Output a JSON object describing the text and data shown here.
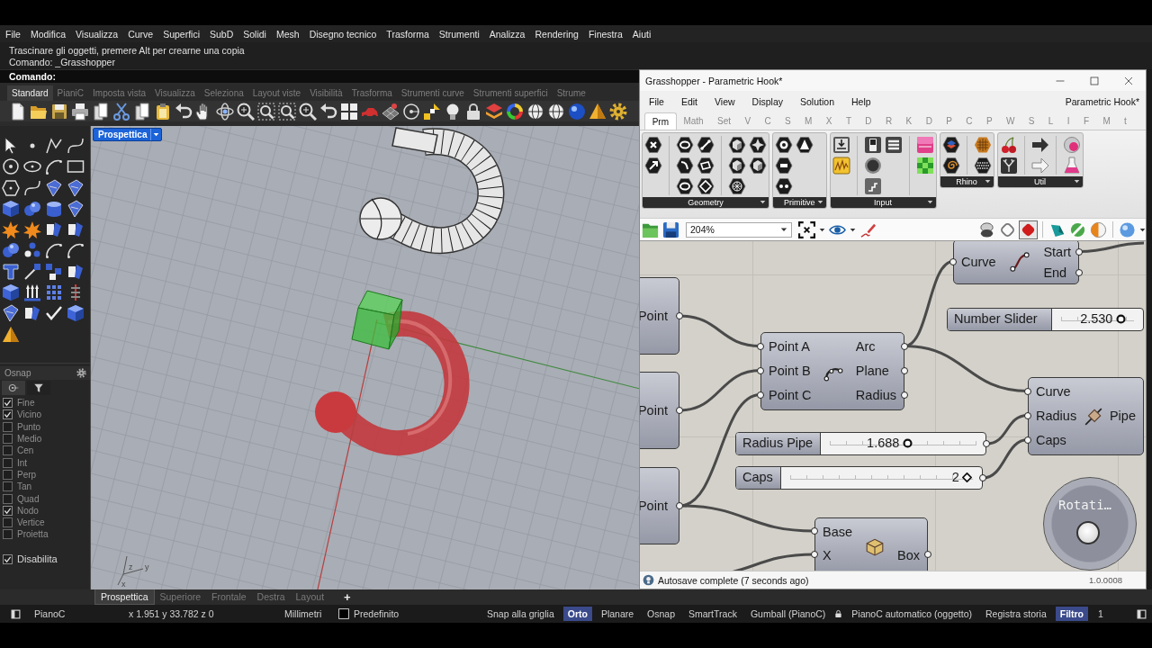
{
  "rhino": {
    "menu": [
      "File",
      "Modifica",
      "Visualizza",
      "Curve",
      "Superfici",
      "SubD",
      "Solidi",
      "Mesh",
      "Disegno tecnico",
      "Trasforma",
      "Strumenti",
      "Analizza",
      "Rendering",
      "Finestra",
      "Aiuti"
    ],
    "command_history": [
      "Trascinare gli oggetti, premere Alt per crearne una copia",
      "Comando: _Grasshopper"
    ],
    "command_prompt": "Comando:",
    "toolbar_tabs": [
      {
        "label": "Standard",
        "selected": true
      },
      {
        "label": "PianiC",
        "selected": false
      },
      {
        "label": "Imposta vista",
        "selected": false
      },
      {
        "label": "Visualizza",
        "selected": false
      },
      {
        "label": "Seleziona",
        "selected": false
      },
      {
        "label": "Layout viste",
        "selected": false
      },
      {
        "label": "Visibilità",
        "selected": false
      },
      {
        "label": "Trasforma",
        "selected": false
      },
      {
        "label": "Strumenti curve",
        "selected": false
      },
      {
        "label": "Strumenti superfici",
        "selected": false
      },
      {
        "label": "Strume",
        "selected": false
      }
    ],
    "viewport": {
      "label": "Prospettica",
      "axis_labels": [
        "z",
        "y",
        "x"
      ]
    },
    "osnap": {
      "title": "Osnap",
      "tabs": [
        {
          "selected": true
        },
        {
          "selected": false
        }
      ],
      "items": [
        {
          "label": "Fine",
          "checked": true
        },
        {
          "label": "Vicino",
          "checked": true
        },
        {
          "label": "Punto",
          "checked": false
        },
        {
          "label": "Medio",
          "checked": false
        },
        {
          "label": "Cen",
          "checked": false
        },
        {
          "label": "Int",
          "checked": false
        },
        {
          "label": "Perp",
          "checked": false
        },
        {
          "label": "Tan",
          "checked": false
        },
        {
          "label": "Quad",
          "checked": false
        },
        {
          "label": "Nodo",
          "checked": true
        },
        {
          "label": "Vertice",
          "checked": false
        },
        {
          "label": "Proietta",
          "checked": false
        }
      ],
      "disable": {
        "label": "Disabilita",
        "checked": true
      }
    },
    "viewport_tabs": [
      {
        "label": "Prospettica",
        "selected": true
      },
      {
        "label": "Superiore",
        "selected": false
      },
      {
        "label": "Frontale",
        "selected": false
      },
      {
        "label": "Destra",
        "selected": false
      },
      {
        "label": "Layout",
        "selected": false
      }
    ],
    "add_tab": "+",
    "status_bar": {
      "plane": "PianoC",
      "coordinates": "x 1.951 y 33.782 z 0",
      "units": "Millimetri",
      "layer": "Predefinito",
      "toggles": [
        {
          "label": "Snap alla griglia",
          "on": false,
          "kind": "plain"
        },
        {
          "label": "Orto",
          "on": true,
          "kind": "plain"
        },
        {
          "label": "Planare",
          "on": false,
          "kind": "plain"
        },
        {
          "label": "Osnap",
          "on": false,
          "kind": "plain"
        },
        {
          "label": "SmartTrack",
          "on": false,
          "kind": "plain"
        },
        {
          "label": "Gumball (PianoC)",
          "on": false,
          "kind": "plain"
        },
        {
          "label": "PianoC automatico (oggetto)",
          "on": false,
          "kind": "locked"
        },
        {
          "label": "Registra storia",
          "on": false,
          "kind": "plain"
        },
        {
          "label": "Filtro",
          "on": true,
          "kind": "plain"
        }
      ],
      "extra": "1"
    }
  },
  "grasshopper": {
    "title": "Grasshopper - Parametric Hook*",
    "menu": [
      "File",
      "Edit",
      "View",
      "Display",
      "Solution",
      "Help"
    ],
    "document_name": "Parametric Hook*",
    "tabs": [
      {
        "label": "Prm",
        "selected": true
      },
      {
        "label": "Math",
        "selected": false
      },
      {
        "label": "Set",
        "selected": false
      },
      {
        "label": "V",
        "selected": false
      },
      {
        "label": "C",
        "selected": false
      },
      {
        "label": "S",
        "selected": false
      },
      {
        "label": "M",
        "selected": false
      },
      {
        "label": "X",
        "selected": false
      },
      {
        "label": "T",
        "selected": false
      },
      {
        "label": "D",
        "selected": false
      },
      {
        "label": "R",
        "selected": false
      },
      {
        "label": "K",
        "selected": false
      },
      {
        "label": "D",
        "selected": false
      },
      {
        "label": "P",
        "selected": false
      },
      {
        "label": "C",
        "selected": false
      },
      {
        "label": "P",
        "selected": false
      },
      {
        "label": "W",
        "selected": false
      },
      {
        "label": "S",
        "selected": false
      },
      {
        "label": "L",
        "selected": false
      },
      {
        "label": "I",
        "selected": false
      },
      {
        "label": "F",
        "selected": false
      },
      {
        "label": "M",
        "selected": false
      },
      {
        "label": "t",
        "selected": false
      }
    ],
    "ribbon_groups": [
      "Geometry",
      "Primitive",
      "Input",
      "Rhino",
      "Util"
    ],
    "zoom": "204%",
    "preview_modes": [
      {
        "selected": false
      },
      {
        "selected": false
      },
      {
        "selected": true
      }
    ],
    "canvas": {
      "params": [
        {
          "label": "Point"
        },
        {
          "label": "Point"
        },
        {
          "label": "Point"
        }
      ],
      "components": [
        {
          "inputs": [
            "Point A",
            "Point B",
            "Point C"
          ],
          "outputs": [
            "Arc",
            "Plane",
            "Radius"
          ]
        },
        {
          "inputs": [
            "Curve"
          ],
          "outputs": [
            "Start",
            "End"
          ]
        },
        {
          "inputs": [
            "Curve",
            "Radius",
            "Caps"
          ],
          "outputs": [
            "Pipe"
          ]
        },
        {
          "inputs": [
            "Base",
            "X"
          ],
          "outputs": [
            "Box"
          ]
        }
      ],
      "sliders": [
        {
          "label": "Number Slider",
          "value": "2.530",
          "kind": "decimal",
          "level": 0.82
        },
        {
          "label": "Radius Pipe",
          "value": "1.688",
          "kind": "decimal",
          "level": 0.53
        },
        {
          "label": "Caps",
          "value": "2",
          "kind": "integer",
          "level": 0.97
        }
      ],
      "knob": {
        "label": "Rotati…"
      }
    },
    "status": "Autosave complete (7 seconds ago)",
    "version": "1.0.0008"
  }
}
